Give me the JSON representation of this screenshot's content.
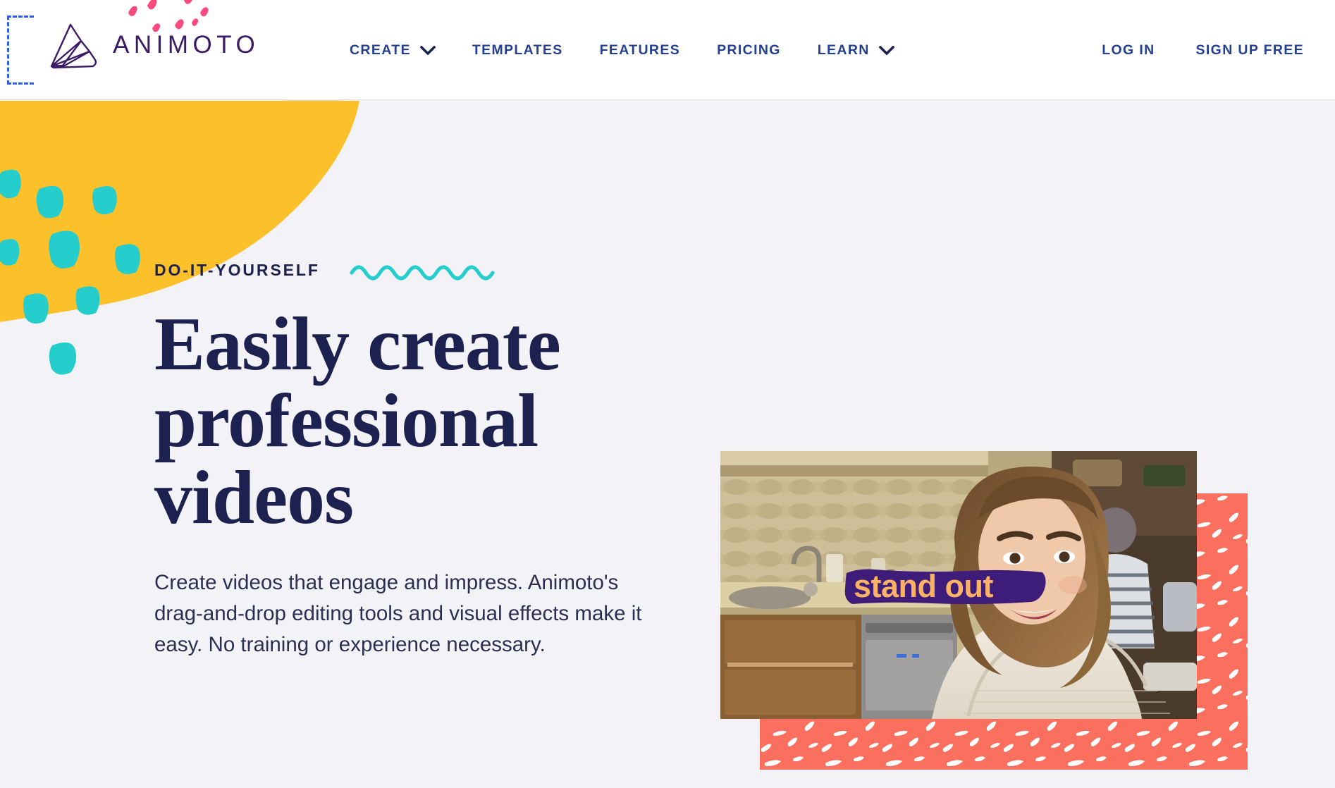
{
  "brand": {
    "name": "ANIMOTO",
    "logo_icon": "animoto-fan-logo-icon"
  },
  "nav": {
    "items": [
      {
        "label": "CREATE",
        "has_dropdown": true,
        "icon": "chevron-down-icon"
      },
      {
        "label": "TEMPLATES",
        "has_dropdown": false
      },
      {
        "label": "FEATURES",
        "has_dropdown": false
      },
      {
        "label": "PRICING",
        "has_dropdown": false
      },
      {
        "label": "LEARN",
        "has_dropdown": true,
        "icon": "chevron-down-icon"
      }
    ],
    "auth": [
      {
        "label": "LOG IN"
      },
      {
        "label": "SIGN UP FREE"
      }
    ]
  },
  "hero": {
    "eyebrow": "DO-IT-YOURSELF",
    "squiggle_icon": "wavy-line-icon",
    "title": "Easily create professional videos",
    "subtitle": "Create videos that engage and impress. Animoto's drag-and-drop editing tools and visual effects make it easy. No training or experience necessary.",
    "video_caption": "stand out"
  },
  "colors": {
    "nav_blue": "#25408f",
    "brand_purple": "#3b1b66",
    "headline_navy": "#1d2150",
    "page_background": "#f2f2f7",
    "header_background": "#ffffff",
    "accent_yellow": "#fbc02a",
    "accent_teal": "#25cdcd",
    "accent_pink": "#fb4a7d",
    "accent_mint": "#cfe8e0",
    "accent_coral": "#fa6f5e",
    "caption_purple": "#3d1c7a",
    "caption_orange": "#fcb265"
  }
}
